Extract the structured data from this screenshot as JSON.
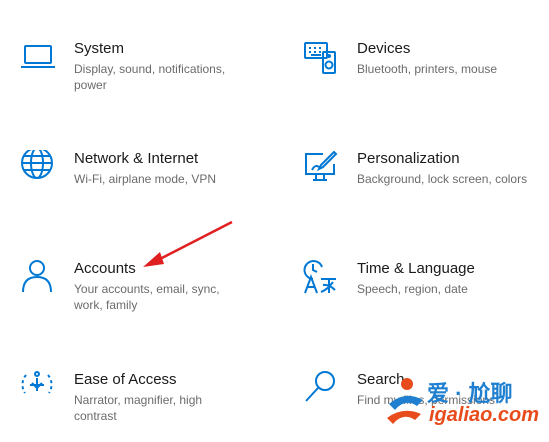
{
  "tiles": [
    {
      "id": "system",
      "title": "System",
      "desc": "Display, sound, notifications, power",
      "icon": "laptop-icon"
    },
    {
      "id": "devices",
      "title": "Devices",
      "desc": "Bluetooth, printers, mouse",
      "icon": "keyboard-speaker-icon"
    },
    {
      "id": "network",
      "title": "Network & Internet",
      "desc": "Wi-Fi, airplane mode, VPN",
      "icon": "globe-icon"
    },
    {
      "id": "personalization",
      "title": "Personalization",
      "desc": "Background, lock screen, colors",
      "icon": "monitor-brush-icon"
    },
    {
      "id": "accounts",
      "title": "Accounts",
      "desc": "Your accounts, email, sync, work, family",
      "icon": "person-icon"
    },
    {
      "id": "time",
      "title": "Time & Language",
      "desc": "Speech, region, date",
      "icon": "clock-language-icon"
    },
    {
      "id": "ease",
      "title": "Ease of Access",
      "desc": "Narrator, magnifier, high contrast",
      "icon": "ease-of-access-icon"
    },
    {
      "id": "search",
      "title": "Search",
      "desc": "Find my files, permissions",
      "icon": "magnifier-icon"
    }
  ],
  "colors": {
    "accent": "#0078d4",
    "arrow": "#e02020"
  },
  "watermark": {
    "cn_text": "爱 · 尬聊",
    "url_text": "igaliao.com"
  }
}
